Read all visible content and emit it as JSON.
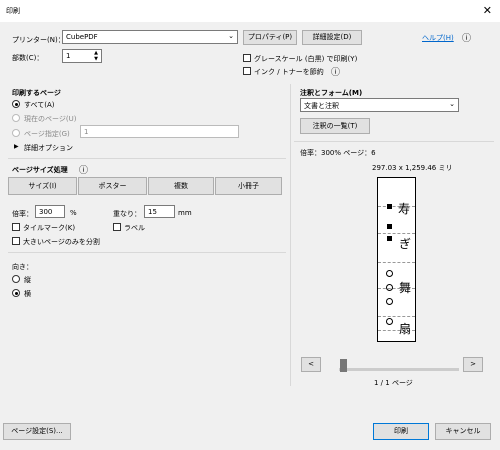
{
  "title": "印刷",
  "printer": {
    "label": "プリンター(N)：",
    "value": "CubePDF",
    "properties": "プロパティ(P)",
    "advanced": "詳細設定(D)"
  },
  "help": "ヘルプ(H)",
  "copies": {
    "label": "部数(C)：",
    "value": "1"
  },
  "grayscale": "グレースケール (白黒) で印刷(Y)",
  "save_ink": "インク / トナーを節約",
  "pages": {
    "title": "印刷するページ",
    "all": "すべて(A)",
    "current": "現在のページ(U)",
    "specify": "ページ指定(G)",
    "range": "1",
    "more": "詳細オプション"
  },
  "sizing": {
    "title": "ページサイズ処理",
    "size": "サイズ(I)",
    "poster": "ポスター",
    "multiple": "複数",
    "booklet": "小冊子",
    "scale_label": "倍率：",
    "scale_value": "300",
    "scale_unit": "%",
    "overlap_label": "重なり：",
    "overlap_value": "15",
    "overlap_unit": "mm",
    "tile_marks": "タイルマーク(K)",
    "labels": "ラベル",
    "large_only": "大きいページのみを分割"
  },
  "orientation": {
    "title": "向き：",
    "portrait": "縦",
    "landscape": "横"
  },
  "comments": {
    "title": "注釈とフォーム(M)",
    "value": "文書と注釈",
    "list_button": "注釈の一覧(T)"
  },
  "preview": {
    "info": "倍率：300% ページ：6",
    "size": "297.03 x 1,259.46 ミリ",
    "page_indicator": "1 / 1 ページ",
    "chars": [
      "寿",
      "ぎ",
      "舞",
      "扇"
    ],
    "prev": "<",
    "next": ">"
  },
  "footer": {
    "page_setup": "ページ設定(S)...",
    "print": "印刷",
    "cancel": "キャンセル"
  }
}
